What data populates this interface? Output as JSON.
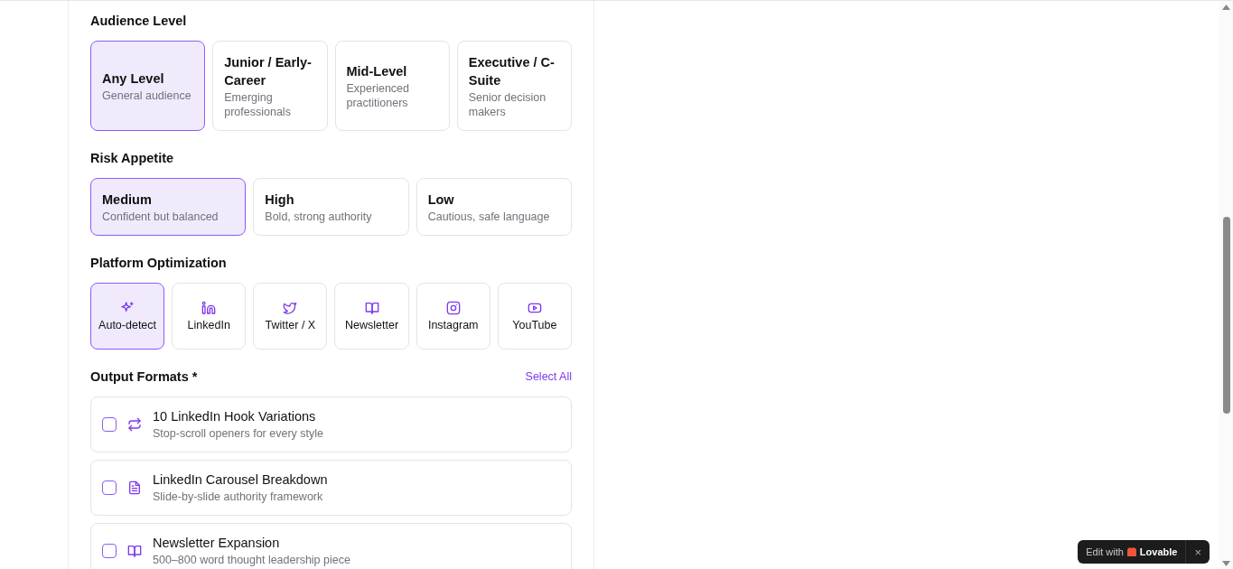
{
  "audience_level": {
    "title": "Audience Level",
    "options": [
      {
        "label": "Any Level",
        "description": "General audience",
        "selected": true
      },
      {
        "label": "Junior / Early-Career",
        "description": "Emerging professionals",
        "selected": false
      },
      {
        "label": "Mid-Level",
        "description": "Experienced practitioners",
        "selected": false
      },
      {
        "label": "Executive / C-Suite",
        "description": "Senior decision makers",
        "selected": false
      }
    ]
  },
  "risk_appetite": {
    "title": "Risk Appetite",
    "options": [
      {
        "label": "Medium",
        "description": "Confident but balanced",
        "selected": true
      },
      {
        "label": "High",
        "description": "Bold, strong authority",
        "selected": false
      },
      {
        "label": "Low",
        "description": "Cautious, safe language",
        "selected": false
      }
    ]
  },
  "platform_optimization": {
    "title": "Platform Optimization",
    "options": [
      {
        "label": "Auto-detect",
        "kind": "sparkles",
        "selected": true
      },
      {
        "label": "LinkedIn",
        "kind": "linkedin",
        "selected": false
      },
      {
        "label": "Twitter / X",
        "kind": "twitter",
        "selected": false
      },
      {
        "label": "Newsletter",
        "kind": "book",
        "selected": false
      },
      {
        "label": "Instagram",
        "kind": "instagram",
        "selected": false
      },
      {
        "label": "YouTube",
        "kind": "youtube",
        "selected": false
      }
    ]
  },
  "output_formats": {
    "title": "Output Formats *",
    "select_all": "Select All",
    "items": [
      {
        "title": "10 LinkedIn Hook Variations",
        "description": "Stop-scroll openers for every style",
        "kind": "repeat",
        "checked": false
      },
      {
        "title": "LinkedIn Carousel Breakdown",
        "description": "Slide-by-slide authority framework",
        "kind": "file",
        "checked": false
      },
      {
        "title": "Newsletter Expansion",
        "description": "500–800 word thought leadership piece",
        "kind": "book",
        "checked": false
      }
    ]
  },
  "badge": {
    "text": "Edit with",
    "brand": "Lovable",
    "close": "×"
  }
}
